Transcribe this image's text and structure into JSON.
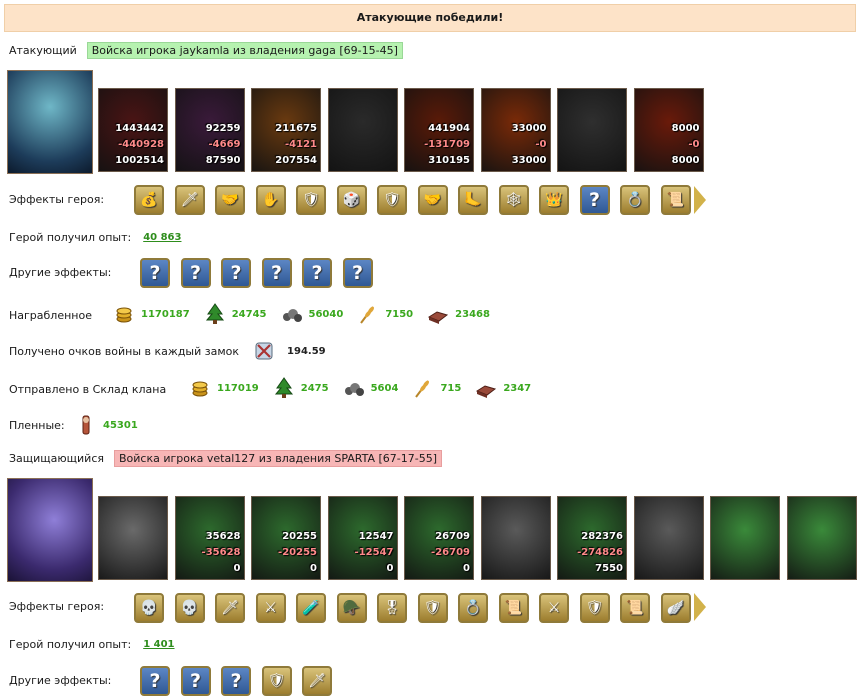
{
  "banner": "Атакующие победили!",
  "attacker": {
    "label": "Атакующий",
    "tag": "Войска игрока jaykamla из владения gaga [69-15-45]",
    "units": [
      {
        "a": "1443442",
        "b": "-440928",
        "c": "1002514",
        "bg": "#4a1414"
      },
      {
        "a": "92259",
        "b": "-4669",
        "c": "87590",
        "bg": "#3a1a3a"
      },
      {
        "a": "211675",
        "b": "-4121",
        "c": "207554",
        "bg": "#6a3a10"
      },
      {
        "a": "",
        "b": "",
        "c": "",
        "bg": "#2a2a2a"
      },
      {
        "a": "441904",
        "b": "-131709",
        "c": "310195",
        "bg": "#5a1a08"
      },
      {
        "a": "33000",
        "b": "-0",
        "c": "33000",
        "bg": "#7a2a08"
      },
      {
        "a": "",
        "b": "",
        "c": "",
        "bg": "#2f2f2f"
      },
      {
        "a": "8000",
        "b": "-0",
        "c": "8000",
        "bg": "#6a1a0a"
      }
    ],
    "effects_label": "Эффекты героя:",
    "effects": [
      "💰",
      "🗡",
      "🤝",
      "✋",
      "🛡",
      "🎲",
      "🛡",
      "🤝",
      "🦶",
      "🕸",
      "👑",
      "?",
      "💍",
      "📜"
    ],
    "exp_label": "Герой получил опыт:",
    "exp": "40 863",
    "other_label": "Другие эффекты:",
    "other": [
      "?",
      "?",
      "?",
      "?",
      "?",
      "?"
    ],
    "loot_label": "Награбленное",
    "loot": [
      {
        "icon": "gold-coins-icon",
        "v": "1170187"
      },
      {
        "icon": "wood-tree-icon",
        "v": "24745"
      },
      {
        "icon": "ore-stones-icon",
        "v": "56040"
      },
      {
        "icon": "wheat-icon",
        "v": "7150"
      },
      {
        "icon": "bricks-icon",
        "v": "23468"
      }
    ],
    "war_label": "Получено очков войны в каждый замок",
    "war_value": "194.59",
    "clan_label": "Отправлено в Склад клана",
    "clan": [
      {
        "icon": "gold-coins-icon",
        "v": "117019"
      },
      {
        "icon": "wood-tree-icon",
        "v": "2475"
      },
      {
        "icon": "ore-stones-icon",
        "v": "5604"
      },
      {
        "icon": "wheat-icon",
        "v": "715"
      },
      {
        "icon": "bricks-icon",
        "v": "2347"
      }
    ],
    "prisoners_label": "Пленные:",
    "prisoners": "45301"
  },
  "defender": {
    "label": "Защищающийся",
    "tag": "Войска игрока vetal127 из владения SPARTA [67-17-55]",
    "units": [
      {
        "a": "",
        "b": "",
        "c": "",
        "bg": "#6a6a6a"
      },
      {
        "a": "35628",
        "b": "-35628",
        "c": "0",
        "bg": "#2d6a2d"
      },
      {
        "a": "20255",
        "b": "-20255",
        "c": "0",
        "bg": "#2d6a2d"
      },
      {
        "a": "12547",
        "b": "-12547",
        "c": "0",
        "bg": "#2d6a2d"
      },
      {
        "a": "26709",
        "b": "-26709",
        "c": "0",
        "bg": "#2d6a2d"
      },
      {
        "a": "",
        "b": "",
        "c": "",
        "bg": "#5a5a5a"
      },
      {
        "a": "282376",
        "b": "-274826",
        "c": "7550",
        "bg": "#2d6a2d"
      },
      {
        "a": "",
        "b": "",
        "c": "",
        "bg": "#5a5a5a"
      },
      {
        "a": "",
        "b": "",
        "c": "",
        "bg": "#3a8a3a"
      },
      {
        "a": "",
        "b": "",
        "c": "",
        "bg": "#3a8a3a"
      }
    ],
    "effects_label": "Эффекты героя:",
    "effects": [
      "💀",
      "💀",
      "🗡",
      "⚔",
      "🧪",
      "🪖",
      "🎖",
      "🛡",
      "💍",
      "📜",
      "⚔",
      "🛡",
      "📜",
      "🪽"
    ],
    "exp_label": "Герой получил опыт:",
    "exp": "1 401",
    "other_label": "Другие эффекты:",
    "other": [
      "?",
      "?",
      "?",
      "🛡",
      "🗡"
    ]
  }
}
